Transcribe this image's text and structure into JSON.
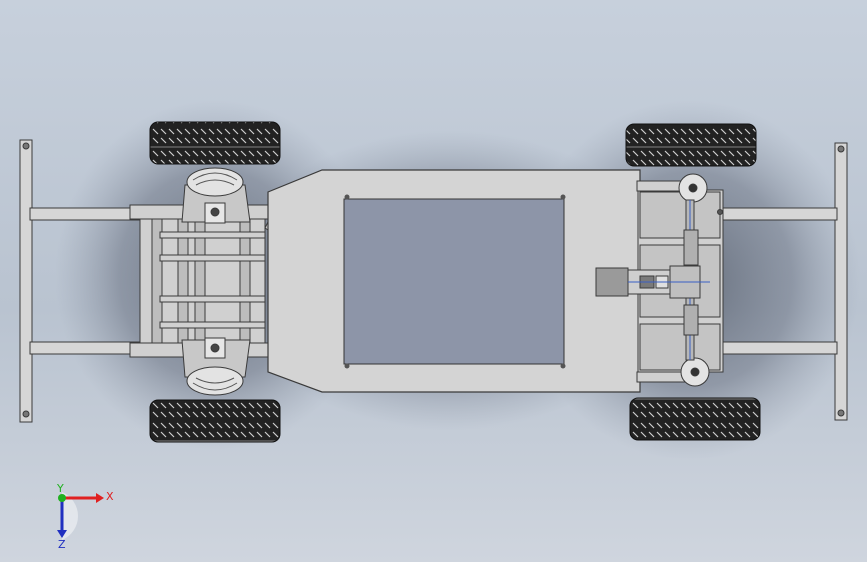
{
  "triad": {
    "x_label": "X",
    "y_label": "Y",
    "z_label": "Z",
    "x_color": "#e02020",
    "y_color": "#20b020",
    "z_color": "#2030c0"
  },
  "colors": {
    "background": "#c4cdd9",
    "frame_metal": "#d2d2d2",
    "frame_stroke": "#444444",
    "deck_panel": "#8a92a6",
    "tire": "#1a1a1a"
  }
}
